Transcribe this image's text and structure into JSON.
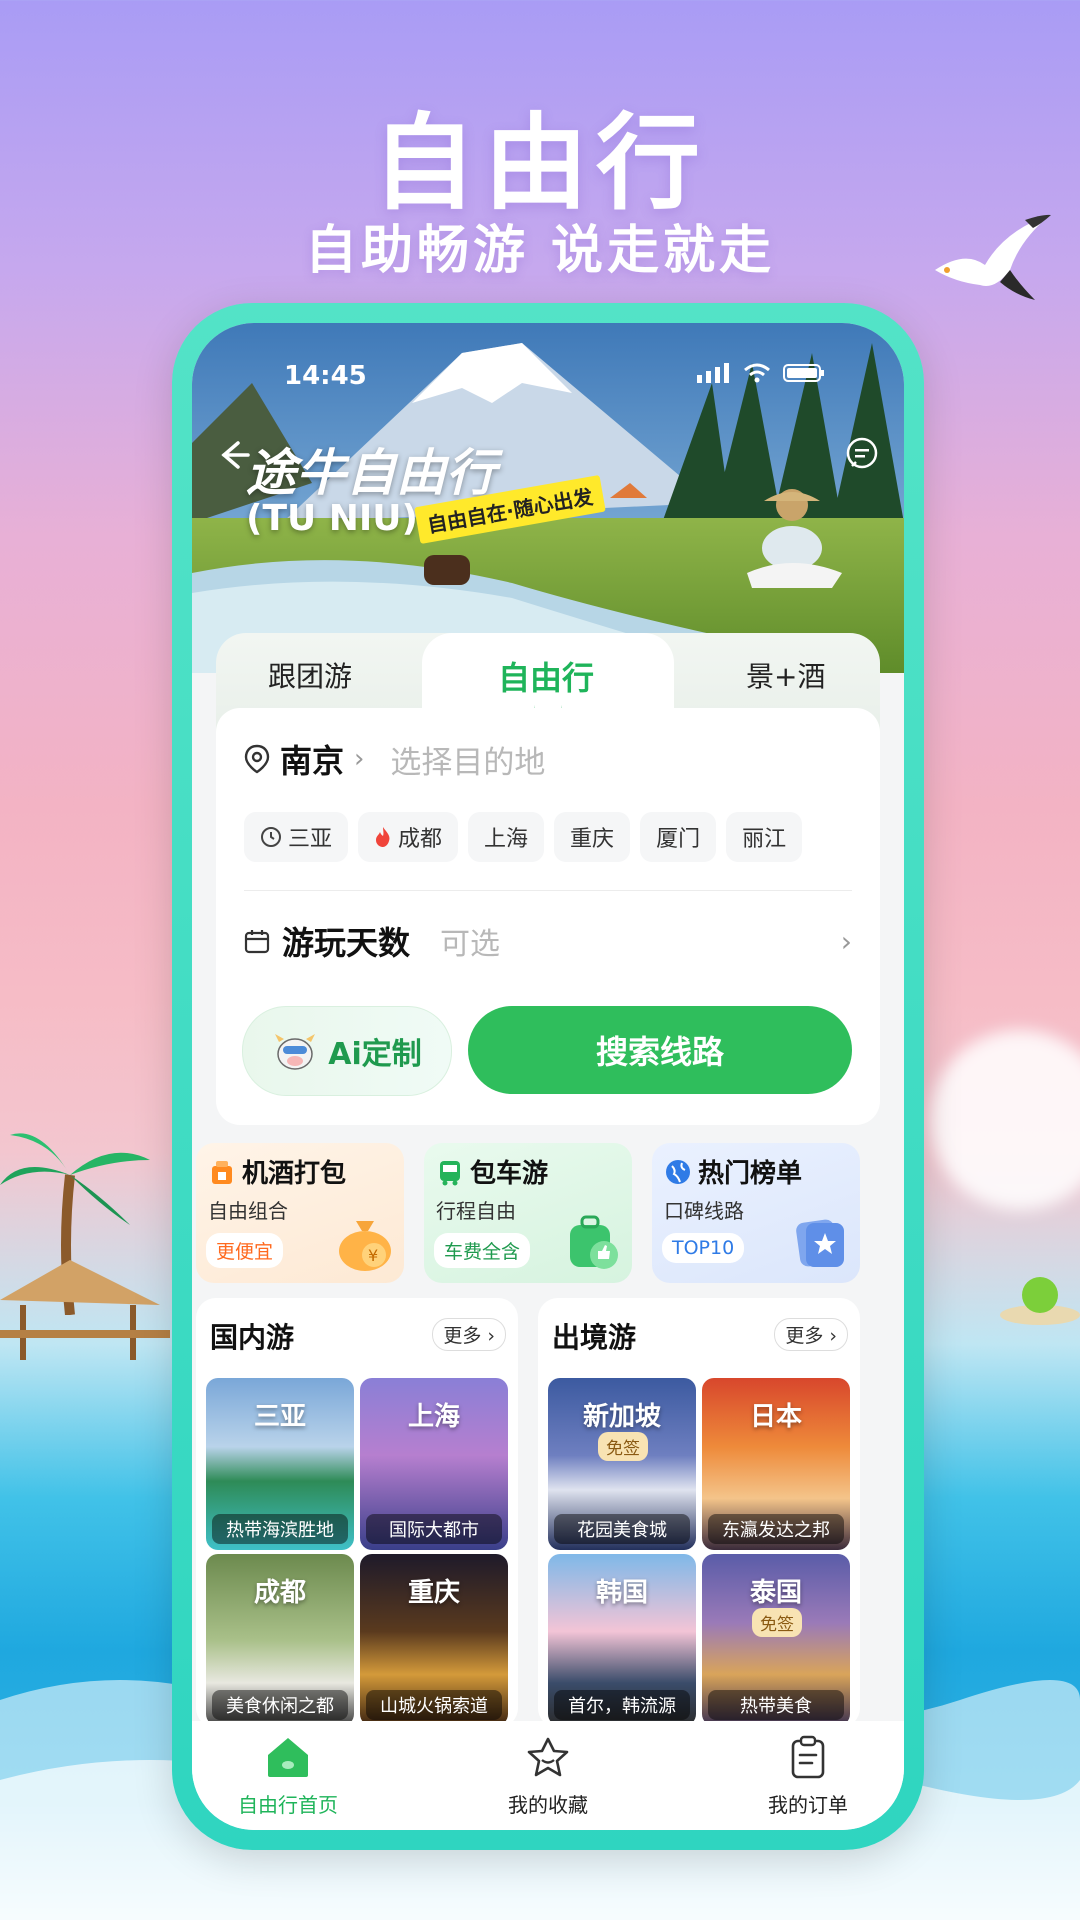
{
  "promo": {
    "title": "自由行",
    "subtitle": "自助畅游 说走就走"
  },
  "status_bar": {
    "time": "14:45"
  },
  "hero": {
    "brand": "途牛自由行",
    "brand_en": "(TU NIU)",
    "tagline": "自由自在·随心出发"
  },
  "tabs": [
    {
      "label": "跟团游",
      "active": false
    },
    {
      "label": "自由行",
      "active": true
    },
    {
      "label": "景+酒",
      "active": false
    }
  ],
  "search": {
    "origin": "南京",
    "destination_placeholder": "选择目的地",
    "hot_cities": [
      {
        "label": "三亚",
        "icon": "clock-icon"
      },
      {
        "label": "成都",
        "icon": "fire-icon"
      },
      {
        "label": "上海",
        "icon": ""
      },
      {
        "label": "重庆",
        "icon": ""
      },
      {
        "label": "厦门",
        "icon": ""
      },
      {
        "label": "丽江",
        "icon": ""
      }
    ],
    "days_label": "游玩天数",
    "days_placeholder": "可选",
    "ai_button": "Ai定制",
    "search_button": "搜索线路"
  },
  "features": [
    {
      "title": "机酒打包",
      "subtitle": "自由组合",
      "badge": "更便宜",
      "icon": "hotel-icon",
      "illustration": "money-bag-icon"
    },
    {
      "title": "包车游",
      "subtitle": "行程自由",
      "badge": "车费全含",
      "icon": "bus-icon",
      "illustration": "thumbs-up-bag-icon"
    },
    {
      "title": "热门榜单",
      "subtitle": "口碑线路",
      "badge": "TOP10",
      "icon": "globe-icon",
      "illustration": "star-card-icon"
    }
  ],
  "domestic": {
    "title": "国内游",
    "more": "更多",
    "tiles": [
      {
        "name": "三亚",
        "caption": "热带海滨胜地",
        "visa": ""
      },
      {
        "name": "上海",
        "caption": "国际大都市",
        "visa": ""
      },
      {
        "name": "成都",
        "caption": "美食休闲之都",
        "visa": ""
      },
      {
        "name": "重庆",
        "caption": "山城火锅索道",
        "visa": ""
      }
    ]
  },
  "abroad": {
    "title": "出境游",
    "more": "更多",
    "tiles": [
      {
        "name": "新加坡",
        "caption": "花园美食城",
        "visa": "免签"
      },
      {
        "name": "日本",
        "caption": "东瀛发达之邦",
        "visa": ""
      },
      {
        "name": "韩国",
        "caption": "首尔，韩流源",
        "visa": ""
      },
      {
        "name": "泰国",
        "caption": "热带美食",
        "visa": "免签"
      }
    ]
  },
  "tabbar": [
    {
      "label": "自由行首页",
      "icon": "home-icon",
      "active": true
    },
    {
      "label": "我的收藏",
      "icon": "star-icon",
      "active": false
    },
    {
      "label": "我的订单",
      "icon": "clipboard-icon",
      "active": false
    }
  ],
  "colors": {
    "accent": "#2fbe5c",
    "phone_frame": "#3ddbc4"
  }
}
